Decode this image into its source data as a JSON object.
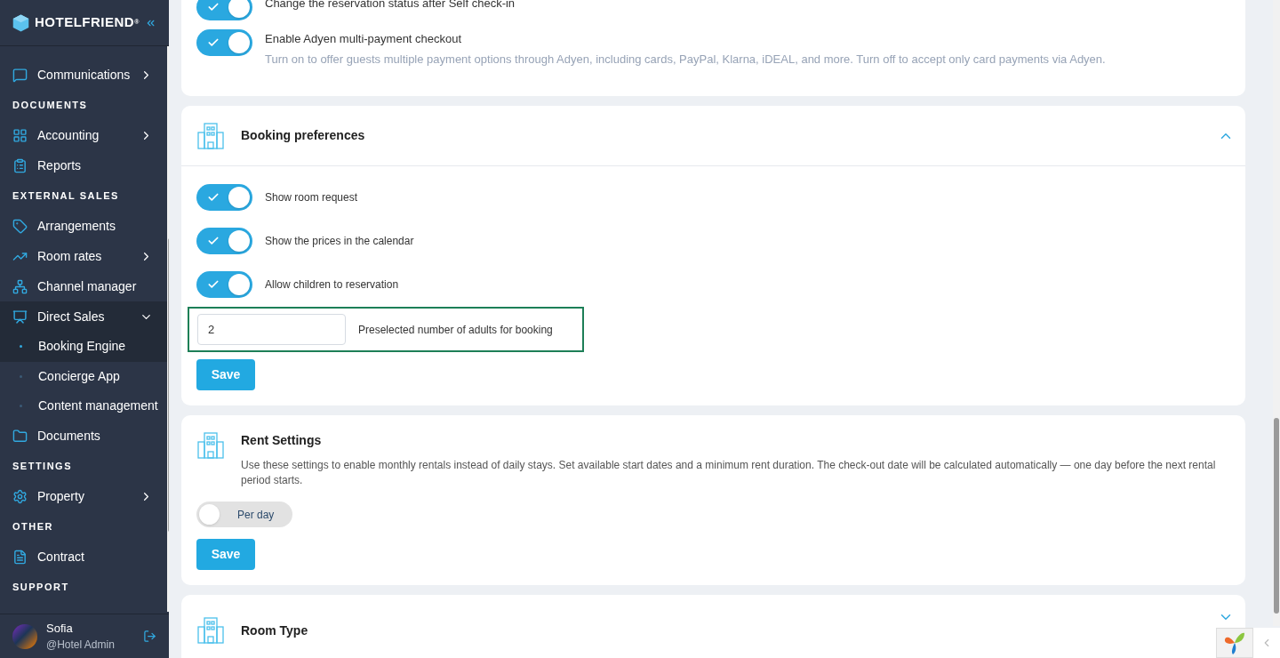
{
  "brand": {
    "name": "HOTELFRIEND",
    "mark": "®"
  },
  "sidebar": {
    "items": [
      {
        "kind": "item",
        "label": "Communications",
        "expanded": false,
        "selected": false
      },
      {
        "kind": "section",
        "label": "DOCUMENTS"
      },
      {
        "kind": "item",
        "label": "Accounting",
        "expanded": false,
        "selected": false
      },
      {
        "kind": "item",
        "label": "Reports",
        "selected": false
      },
      {
        "kind": "section",
        "label": "EXTERNAL SALES"
      },
      {
        "kind": "item",
        "label": "Arrangements",
        "selected": false
      },
      {
        "kind": "item",
        "label": "Room rates",
        "expanded": false,
        "selected": false
      },
      {
        "kind": "item",
        "label": "Channel manager",
        "selected": false
      },
      {
        "kind": "item",
        "label": "Direct Sales",
        "expanded": true,
        "selected": true,
        "children": [
          {
            "label": "Booking Engine",
            "selected": true
          },
          {
            "label": "Concierge App",
            "selected": false
          },
          {
            "label": "Content management",
            "selected": false
          }
        ]
      },
      {
        "kind": "item",
        "label": "Documents",
        "selected": false
      },
      {
        "kind": "section",
        "label": "SETTINGS"
      },
      {
        "kind": "item",
        "label": "Property",
        "expanded": false,
        "selected": false
      },
      {
        "kind": "section",
        "label": "OTHER"
      },
      {
        "kind": "item",
        "label": "Contract",
        "selected": false
      },
      {
        "kind": "section",
        "label": "SUPPORT"
      }
    ]
  },
  "user": {
    "name": "Sofia",
    "role": "@Hotel Admin"
  },
  "top_card": {
    "toggles": [
      {
        "label": "Change the reservation status after Self check-in",
        "on": true
      },
      {
        "label": "Enable Adyen multi-payment checkout",
        "on": true,
        "description": "Turn on to offer guests multiple payment options through Adyen, including cards, PayPal, Klarna, iDEAL, and more. Turn off to accept only card payments via Adyen."
      }
    ]
  },
  "booking_preferences": {
    "title": "Booking preferences",
    "expanded": true,
    "toggles": [
      {
        "label": "Show room request",
        "on": true
      },
      {
        "label": "Show the prices in the calendar",
        "on": true
      },
      {
        "label": "Allow children to reservation",
        "on": true
      }
    ],
    "adults_field": {
      "value": "2",
      "label": "Preselected number of adults for booking",
      "highlighted": true
    },
    "save": "Save"
  },
  "rent_settings": {
    "title": "Rent Settings",
    "description": "Use these settings to enable monthly rentals instead of daily stays. Set available start dates and a minimum rent duration. The check-out date will be calculated automatically — one day before the next rental period starts.",
    "switch": {
      "label": "Per day",
      "on": false
    },
    "save": "Save"
  },
  "room_type": {
    "title": "Room Type",
    "expanded": false
  }
}
